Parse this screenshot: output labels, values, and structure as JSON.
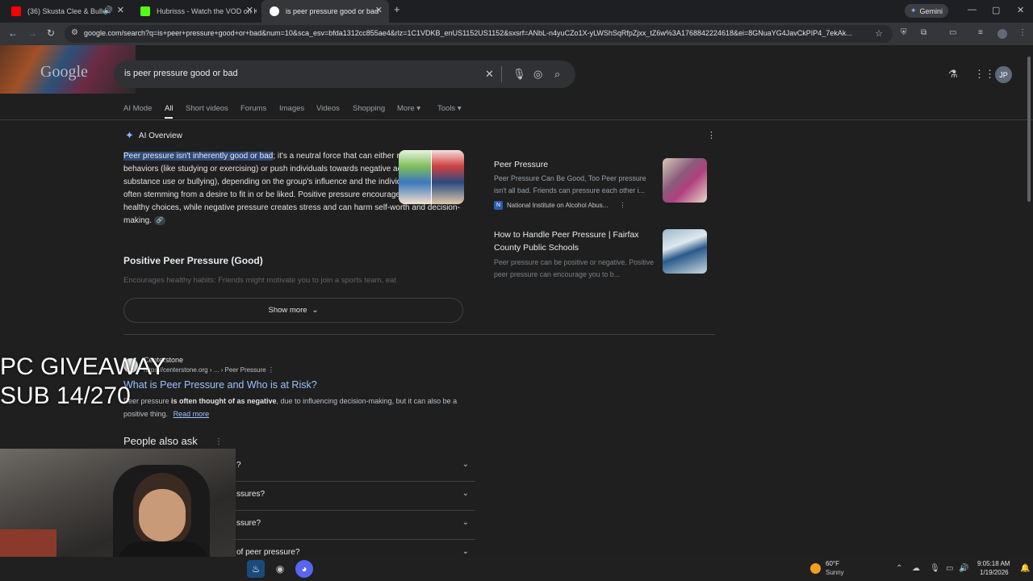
{
  "browser": {
    "tabs": [
      {
        "title": "(36) Skusta Clee & Bullet D",
        "favicon_color": "#ff0000"
      },
      {
        "title": "Hubrisss - Watch the VOD on K",
        "favicon_color": "#53fc18"
      },
      {
        "title": "is peer pressure good or bad -",
        "favicon_color": "#ffffff"
      }
    ],
    "new_tab": "+",
    "gemini_label": "Gemini",
    "url": "google.com/search?q=is+peer+pressure+good+or+bad&num=10&sca_esv=bfda1312cc855ae4&rlz=1C1VDKB_enUS1152US1152&sxsrf=ANbL-n4yuCZo1X-yLWShSqRfpZjxx_tZ6w%3A1768842224618&ei=8GNuaYG4JavCkPIP4_7ekAk..."
  },
  "search": {
    "logo": "Google",
    "query": "is peer pressure good or bad",
    "avatar": "JP",
    "tabs": [
      "AI Mode",
      "All",
      "Short videos",
      "Forums",
      "Images",
      "Videos",
      "Shopping",
      "More ▾",
      "Tools ▾"
    ]
  },
  "ai_overview": {
    "label": "AI Overview",
    "highlight": "Peer pressure isn't inherently good or bad",
    "body": "; it's a neutral force that can either motivate positive behaviors (like studying or exercising) or push individuals towards negative actions (like substance use or bullying), depending on the group's influence and the individual's resilience, often stemming from a desire to fit in or be liked. Positive pressure encourages growth and healthy choices, while negative pressure creates stress and can harm self-worth and decision-making.",
    "section_title": "Positive Peer Pressure (Good)",
    "faded_bullet": "Encourages healthy habits: Friends might motivate you to join a sports team, eat",
    "show_more": "Show more",
    "cards": [
      {
        "title": "Peer Pressure",
        "snippet": "Peer Pressure Can Be Good, Too Peer pressure isn't all bad. Friends can pressure each other i...",
        "source": "National Institute on Alcohol Abus...",
        "source_icon": "N"
      },
      {
        "title": "How to Handle Peer Pressure | Fairfax County Public Schools",
        "snippet": "Peer pressure can be positive or negative. Positive peer pressure can encourage you to b..."
      }
    ]
  },
  "result": {
    "site": "Centerstone",
    "url": "https://centerstone.org › ... › Peer Pressure",
    "title": "What is Peer Pressure and Who is at Risk?",
    "snippet_pre": "Peer pressure ",
    "snippet_bold": "is often thought of as negative",
    "snippet_post": ", due to influencing decision-making, but it can also be a positive thing.",
    "read_more": "Read more"
  },
  "people_also_ask": {
    "title": "People also ask",
    "questions": [
      "?",
      "ssures?",
      "ssure?",
      "of peer pressure?"
    ]
  },
  "overlay": {
    "line1": "PC GIVEAWAY",
    "line2": "SUB 14/270"
  },
  "taskbar": {
    "temperature": "60°F",
    "condition": "Sunny",
    "time": "9:05:18 AM",
    "date": "1/19/2026"
  }
}
